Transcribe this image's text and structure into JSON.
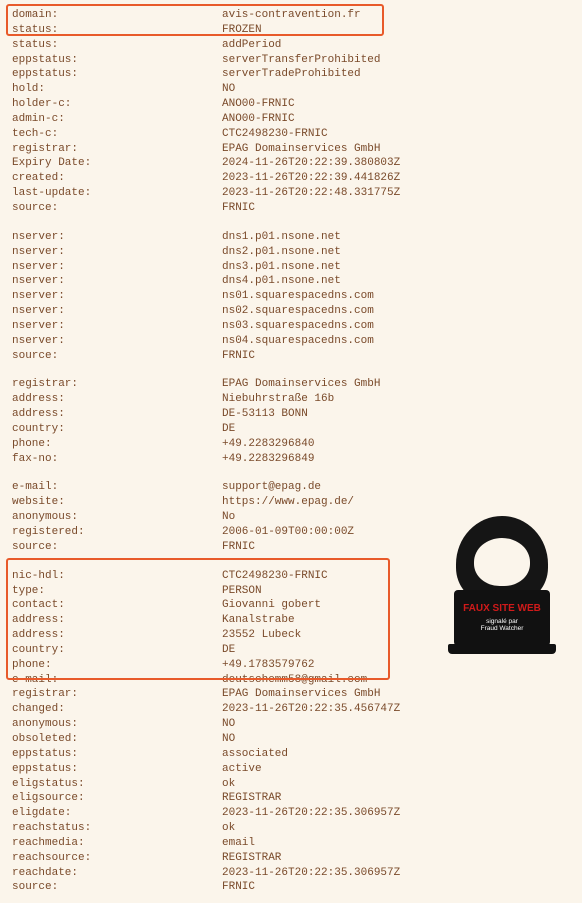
{
  "highlight_top": [
    {
      "k": "domain:",
      "v": "avis-contravention.fr"
    },
    {
      "k": "status:",
      "v": "FROZEN"
    }
  ],
  "block1": [
    {
      "k": "status:",
      "v": "addPeriod"
    },
    {
      "k": "eppstatus:",
      "v": "serverTransferProhibited"
    },
    {
      "k": "eppstatus:",
      "v": "serverTradeProhibited"
    },
    {
      "k": "hold:",
      "v": "NO"
    },
    {
      "k": "holder-c:",
      "v": "ANO00-FRNIC"
    },
    {
      "k": "admin-c:",
      "v": "ANO00-FRNIC"
    },
    {
      "k": "tech-c:",
      "v": "CTC2498230-FRNIC"
    },
    {
      "k": "registrar:",
      "v": "EPAG Domainservices GmbH"
    },
    {
      "k": "Expiry Date:",
      "v": "2024-11-26T20:22:39.380803Z"
    },
    {
      "k": "created:",
      "v": "2023-11-26T20:22:39.441826Z"
    },
    {
      "k": "last-update:",
      "v": "2023-11-26T20:22:48.331775Z"
    },
    {
      "k": "source:",
      "v": "FRNIC"
    }
  ],
  "block2": [
    {
      "k": "nserver:",
      "v": "dns1.p01.nsone.net"
    },
    {
      "k": "nserver:",
      "v": "dns2.p01.nsone.net"
    },
    {
      "k": "nserver:",
      "v": "dns3.p01.nsone.net"
    },
    {
      "k": "nserver:",
      "v": "dns4.p01.nsone.net"
    },
    {
      "k": "nserver:",
      "v": "ns01.squarespacedns.com"
    },
    {
      "k": "nserver:",
      "v": "ns02.squarespacedns.com"
    },
    {
      "k": "nserver:",
      "v": "ns03.squarespacedns.com"
    },
    {
      "k": "nserver:",
      "v": "ns04.squarespacedns.com"
    },
    {
      "k": "source:",
      "v": "FRNIC"
    }
  ],
  "block3": [
    {
      "k": "registrar:",
      "v": "EPAG Domainservices GmbH"
    },
    {
      "k": "address:",
      "v": "Niebuhrstraße 16b"
    },
    {
      "k": "address:",
      "v": "DE-53113 BONN"
    },
    {
      "k": "country:",
      "v": "DE"
    },
    {
      "k": "phone:",
      "v": "+49.2283296840"
    },
    {
      "k": "fax-no:",
      "v": "+49.2283296849"
    }
  ],
  "block4": [
    {
      "k": "e-mail:",
      "v": "support@epag.de"
    },
    {
      "k": "website:",
      "v": "https://www.epag.de/"
    },
    {
      "k": "anonymous:",
      "v": "No"
    },
    {
      "k": "registered:",
      "v": "2006-01-09T00:00:00Z"
    },
    {
      "k": "source:",
      "v": "FRNIC"
    }
  ],
  "highlight_mid": [
    {
      "k": "nic-hdl:",
      "v": "CTC2498230-FRNIC"
    },
    {
      "k": "type:",
      "v": "PERSON"
    },
    {
      "k": "contact:",
      "v": "Giovanni gobert"
    },
    {
      "k": "address:",
      "v": "Kanalstrabe"
    },
    {
      "k": "address:",
      "v": "23552 Lubeck"
    },
    {
      "k": "country:",
      "v": "DE"
    },
    {
      "k": "phone:",
      "v": "+49.1783579762"
    },
    {
      "k": "e-mail:",
      "v": "deutschemm58@gmail.com"
    }
  ],
  "block5": [
    {
      "k": "registrar:",
      "v": "EPAG Domainservices GmbH"
    },
    {
      "k": "changed:",
      "v": "2023-11-26T20:22:35.456747Z"
    },
    {
      "k": "anonymous:",
      "v": "NO"
    },
    {
      "k": "obsoleted:",
      "v": "NO"
    },
    {
      "k": "eppstatus:",
      "v": "associated"
    },
    {
      "k": "eppstatus:",
      "v": "active"
    },
    {
      "k": "eligstatus:",
      "v": "ok"
    },
    {
      "k": "eligsource:",
      "v": "REGISTRAR"
    },
    {
      "k": "eligdate:",
      "v": "2023-11-26T20:22:35.306957Z"
    },
    {
      "k": "reachstatus:",
      "v": "ok"
    },
    {
      "k": "reachmedia:",
      "v": "email"
    },
    {
      "k": "reachsource:",
      "v": "REGISTRAR"
    },
    {
      "k": "reachdate:",
      "v": "2023-11-26T20:22:35.306957Z"
    },
    {
      "k": "source:",
      "v": "FRNIC"
    }
  ],
  "sticker": {
    "line1": "FAUX SITE WEB",
    "line2": "signalé par",
    "line3": "Fraud Watcher"
  }
}
